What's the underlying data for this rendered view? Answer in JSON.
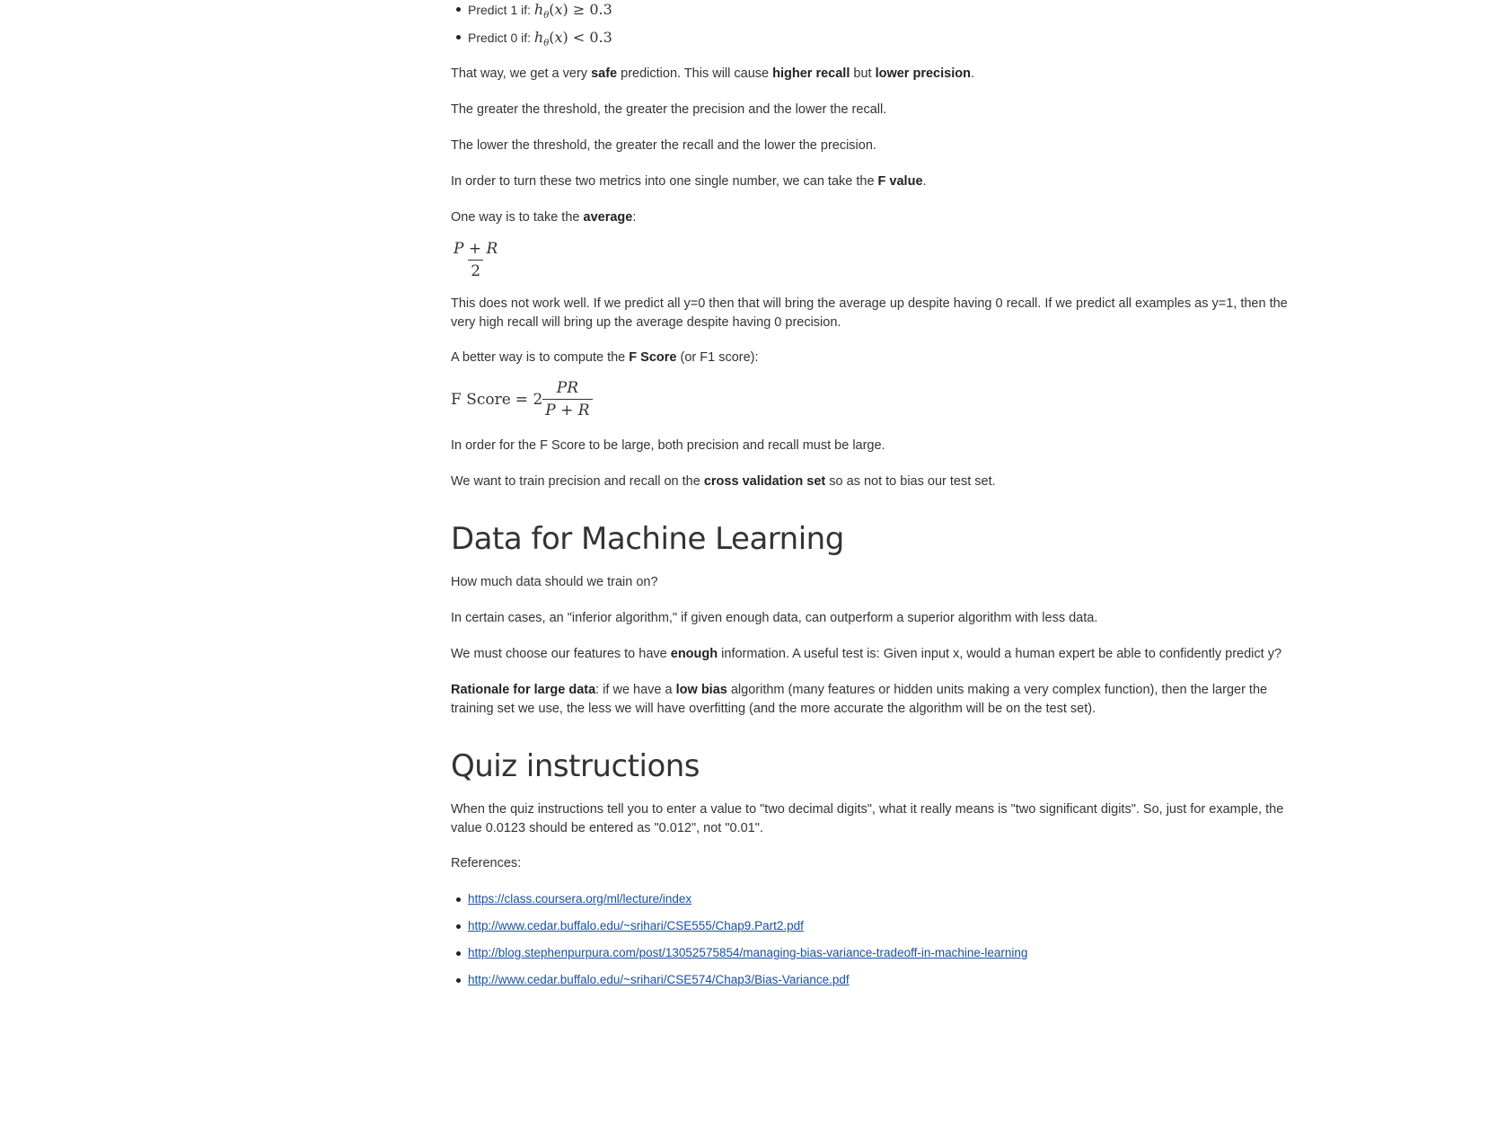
{
  "predictions": [
    {
      "label": "Predict 1 if:",
      "h": "h",
      "theta": "θ",
      "x": "x",
      "op": "≥",
      "value": "0.3"
    },
    {
      "label": "Predict 0 if:",
      "h": "h",
      "theta": "θ",
      "x": "x",
      "op": "<",
      "value": "0.3"
    }
  ],
  "p_safe": {
    "a": "That way, we get a very ",
    "b1": "safe",
    "c": " prediction. This will cause ",
    "b2": "higher recall",
    "d": " but ",
    "b3": "lower precision",
    "e": "."
  },
  "p_greater": "The greater the threshold, the greater the precision and the lower the recall.",
  "p_lower": "The lower the threshold, the greater the recall and the lower the precision.",
  "p_fvalue": {
    "a": "In order to turn these two metrics into one single number, we can take the ",
    "b": "F value",
    "c": "."
  },
  "p_average": {
    "a": "One way is to take the ",
    "b": "average",
    "c": ":"
  },
  "formula_avg": {
    "num": "P + R",
    "den": "2"
  },
  "p_notwork": "This does not work well. If we predict all y=0 then that will bring the average up despite having 0 recall. If we predict all examples as y=1, then the very high recall will bring up the average despite having 0 precision.",
  "p_better": {
    "a": "A better way is to compute the ",
    "b": "F Score",
    "c": " (or F1 score):"
  },
  "formula_f": {
    "lhs": "F Score",
    "eq": "= 2",
    "num": "PR",
    "den": "P + R"
  },
  "p_large": "In order for the F Score to be large, both precision and recall must be large.",
  "p_cv": {
    "a": "We want to train precision and recall on the ",
    "b": "cross validation set",
    "c": " so as not to bias our test set."
  },
  "h_data": "Data for Machine Learning",
  "p_howmuch": "How much data should we train on?",
  "p_inferior": "In certain cases, an \"inferior algorithm,\" if given enough data, can outperform a superior algorithm with less data.",
  "p_enough": {
    "a": "We must choose our features to have ",
    "b": "enough",
    "c": " information. A useful test is: Given input x, would a human expert be able to confidently predict y?"
  },
  "p_rationale": {
    "b1": "Rationale for large data",
    "a": ": if we have a ",
    "b2": "low bias",
    "c": " algorithm (many features or hidden units making a very complex function), then the larger the training set we use, the less we will have overfitting (and the more accurate the algorithm will be on the test set)."
  },
  "h_quiz": "Quiz instructions",
  "p_quiz": "When the quiz instructions tell you to enter a value to \"two decimal digits\", what it really means is \"two significant digits\". So, just for example, the value 0.0123 should be entered as \"0.012\", not \"0.01\".",
  "p_refs": "References:",
  "references": [
    "https://class.coursera.org/ml/lecture/index",
    "http://www.cedar.buffalo.edu/~srihari/CSE555/Chap9.Part2.pdf",
    "http://blog.stephenpurpura.com/post/13052575854/managing-bias-variance-tradeoff-in-machine-learning",
    "http://www.cedar.buffalo.edu/~srihari/CSE574/Chap3/Bias-Variance.pdf"
  ]
}
